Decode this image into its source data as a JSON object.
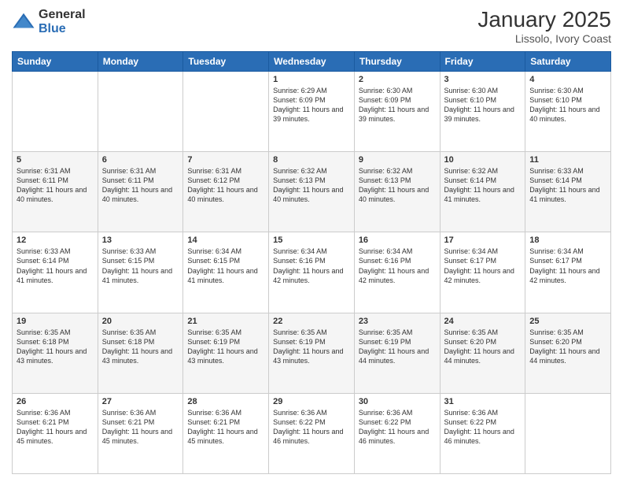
{
  "logo": {
    "general": "General",
    "blue": "Blue"
  },
  "title": "January 2025",
  "subtitle": "Lissolo, Ivory Coast",
  "days_of_week": [
    "Sunday",
    "Monday",
    "Tuesday",
    "Wednesday",
    "Thursday",
    "Friday",
    "Saturday"
  ],
  "weeks": [
    [
      {
        "day": "",
        "info": ""
      },
      {
        "day": "",
        "info": ""
      },
      {
        "day": "",
        "info": ""
      },
      {
        "day": "1",
        "info": "Sunrise: 6:29 AM\nSunset: 6:09 PM\nDaylight: 11 hours and 39 minutes."
      },
      {
        "day": "2",
        "info": "Sunrise: 6:30 AM\nSunset: 6:09 PM\nDaylight: 11 hours and 39 minutes."
      },
      {
        "day": "3",
        "info": "Sunrise: 6:30 AM\nSunset: 6:10 PM\nDaylight: 11 hours and 39 minutes."
      },
      {
        "day": "4",
        "info": "Sunrise: 6:30 AM\nSunset: 6:10 PM\nDaylight: 11 hours and 40 minutes."
      }
    ],
    [
      {
        "day": "5",
        "info": "Sunrise: 6:31 AM\nSunset: 6:11 PM\nDaylight: 11 hours and 40 minutes."
      },
      {
        "day": "6",
        "info": "Sunrise: 6:31 AM\nSunset: 6:11 PM\nDaylight: 11 hours and 40 minutes."
      },
      {
        "day": "7",
        "info": "Sunrise: 6:31 AM\nSunset: 6:12 PM\nDaylight: 11 hours and 40 minutes."
      },
      {
        "day": "8",
        "info": "Sunrise: 6:32 AM\nSunset: 6:13 PM\nDaylight: 11 hours and 40 minutes."
      },
      {
        "day": "9",
        "info": "Sunrise: 6:32 AM\nSunset: 6:13 PM\nDaylight: 11 hours and 40 minutes."
      },
      {
        "day": "10",
        "info": "Sunrise: 6:32 AM\nSunset: 6:14 PM\nDaylight: 11 hours and 41 minutes."
      },
      {
        "day": "11",
        "info": "Sunrise: 6:33 AM\nSunset: 6:14 PM\nDaylight: 11 hours and 41 minutes."
      }
    ],
    [
      {
        "day": "12",
        "info": "Sunrise: 6:33 AM\nSunset: 6:14 PM\nDaylight: 11 hours and 41 minutes."
      },
      {
        "day": "13",
        "info": "Sunrise: 6:33 AM\nSunset: 6:15 PM\nDaylight: 11 hours and 41 minutes."
      },
      {
        "day": "14",
        "info": "Sunrise: 6:34 AM\nSunset: 6:15 PM\nDaylight: 11 hours and 41 minutes."
      },
      {
        "day": "15",
        "info": "Sunrise: 6:34 AM\nSunset: 6:16 PM\nDaylight: 11 hours and 42 minutes."
      },
      {
        "day": "16",
        "info": "Sunrise: 6:34 AM\nSunset: 6:16 PM\nDaylight: 11 hours and 42 minutes."
      },
      {
        "day": "17",
        "info": "Sunrise: 6:34 AM\nSunset: 6:17 PM\nDaylight: 11 hours and 42 minutes."
      },
      {
        "day": "18",
        "info": "Sunrise: 6:34 AM\nSunset: 6:17 PM\nDaylight: 11 hours and 42 minutes."
      }
    ],
    [
      {
        "day": "19",
        "info": "Sunrise: 6:35 AM\nSunset: 6:18 PM\nDaylight: 11 hours and 43 minutes."
      },
      {
        "day": "20",
        "info": "Sunrise: 6:35 AM\nSunset: 6:18 PM\nDaylight: 11 hours and 43 minutes."
      },
      {
        "day": "21",
        "info": "Sunrise: 6:35 AM\nSunset: 6:19 PM\nDaylight: 11 hours and 43 minutes."
      },
      {
        "day": "22",
        "info": "Sunrise: 6:35 AM\nSunset: 6:19 PM\nDaylight: 11 hours and 43 minutes."
      },
      {
        "day": "23",
        "info": "Sunrise: 6:35 AM\nSunset: 6:19 PM\nDaylight: 11 hours and 44 minutes."
      },
      {
        "day": "24",
        "info": "Sunrise: 6:35 AM\nSunset: 6:20 PM\nDaylight: 11 hours and 44 minutes."
      },
      {
        "day": "25",
        "info": "Sunrise: 6:35 AM\nSunset: 6:20 PM\nDaylight: 11 hours and 44 minutes."
      }
    ],
    [
      {
        "day": "26",
        "info": "Sunrise: 6:36 AM\nSunset: 6:21 PM\nDaylight: 11 hours and 45 minutes."
      },
      {
        "day": "27",
        "info": "Sunrise: 6:36 AM\nSunset: 6:21 PM\nDaylight: 11 hours and 45 minutes."
      },
      {
        "day": "28",
        "info": "Sunrise: 6:36 AM\nSunset: 6:21 PM\nDaylight: 11 hours and 45 minutes."
      },
      {
        "day": "29",
        "info": "Sunrise: 6:36 AM\nSunset: 6:22 PM\nDaylight: 11 hours and 46 minutes."
      },
      {
        "day": "30",
        "info": "Sunrise: 6:36 AM\nSunset: 6:22 PM\nDaylight: 11 hours and 46 minutes."
      },
      {
        "day": "31",
        "info": "Sunrise: 6:36 AM\nSunset: 6:22 PM\nDaylight: 11 hours and 46 minutes."
      },
      {
        "day": "",
        "info": ""
      }
    ]
  ]
}
